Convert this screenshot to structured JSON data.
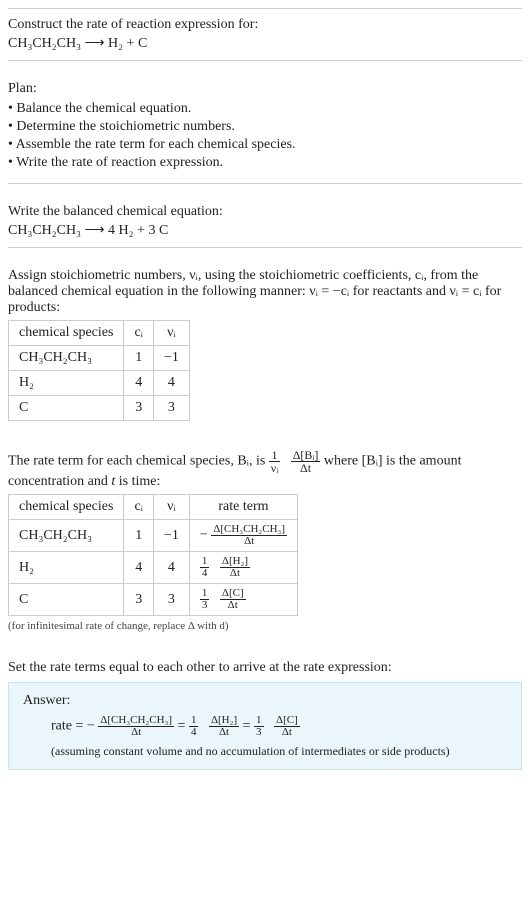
{
  "construct": {
    "title": "Construct the rate of reaction expression for:",
    "equation": "CH₃CH₂CH₃  ⟶  H₂ + C"
  },
  "plan": {
    "title": "Plan:",
    "items": [
      "Balance the chemical equation.",
      "Determine the stoichiometric numbers.",
      "Assemble the rate term for each chemical species.",
      "Write the rate of reaction expression."
    ]
  },
  "balanced": {
    "title": "Write the balanced chemical equation:",
    "equation": "CH₃CH₂CH₃  ⟶  4 H₂ + 3 C"
  },
  "stoich": {
    "intro": "Assign stoichiometric numbers, νᵢ, using the stoichiometric coefficients, cᵢ, from the balanced chemical equation in the following manner: νᵢ = −cᵢ for reactants and νᵢ = cᵢ for products:",
    "headers": {
      "species": "chemical species",
      "c": "cᵢ",
      "v": "νᵢ"
    },
    "rows": [
      {
        "species": "CH₃CH₂CH₃",
        "c": "1",
        "v": "−1"
      },
      {
        "species": "H₂",
        "c": "4",
        "v": "4"
      },
      {
        "species": "C",
        "c": "3",
        "v": "3"
      }
    ]
  },
  "rateterm": {
    "intro_a": "The rate term for each chemical species, Bᵢ, is ",
    "frac1_num": "1",
    "frac1_den": "νᵢ",
    "frac2_num": "Δ[Bᵢ]",
    "frac2_den": "Δt",
    "intro_b": " where [Bᵢ] is the amount concentration and ",
    "intro_c": "t",
    "intro_d": " is time:",
    "headers": {
      "species": "chemical species",
      "c": "cᵢ",
      "v": "νᵢ",
      "rate": "rate term"
    },
    "rows": [
      {
        "species": "CH₃CH₂CH₃",
        "c": "1",
        "v": "−1",
        "lead": "−",
        "a_num": "",
        "a_den": "",
        "b_num": "Δ[CH₃CH₂CH₃]",
        "b_den": "Δt"
      },
      {
        "species": "H₂",
        "c": "4",
        "v": "4",
        "lead": "",
        "a_num": "1",
        "a_den": "4",
        "b_num": "Δ[H₂]",
        "b_den": "Δt"
      },
      {
        "species": "C",
        "c": "3",
        "v": "3",
        "lead": "",
        "a_num": "1",
        "a_den": "3",
        "b_num": "Δ[C]",
        "b_den": "Δt"
      }
    ],
    "note": "(for infinitesimal rate of change, replace Δ with d)"
  },
  "setequal": {
    "title": "Set the rate terms equal to each other to arrive at the rate expression:"
  },
  "answer": {
    "label": "Answer:",
    "prefix": "rate = −",
    "t1_num": "Δ[CH₃CH₂CH₃]",
    "t1_den": "Δt",
    "eq1": " = ",
    "f2a_num": "1",
    "f2a_den": "4",
    "t2_num": "Δ[H₂]",
    "t2_den": "Δt",
    "eq2": " = ",
    "f3a_num": "1",
    "f3a_den": "3",
    "t3_num": "Δ[C]",
    "t3_den": "Δt",
    "note": "(assuming constant volume and no accumulation of intermediates or side products)"
  },
  "chart_data": {
    "type": "table",
    "title": "Stoichiometric numbers and rate terms for CH₃CH₂CH₃ → 4 H₂ + 3 C",
    "columns": [
      "chemical species",
      "cᵢ",
      "νᵢ",
      "rate term"
    ],
    "rows": [
      [
        "CH₃CH₂CH₃",
        1,
        -1,
        "−Δ[CH₃CH₂CH₃]/Δt"
      ],
      [
        "H₂",
        4,
        4,
        "(1/4)Δ[H₂]/Δt"
      ],
      [
        "C",
        3,
        3,
        "(1/3)Δ[C]/Δt"
      ]
    ],
    "rate_expression": "rate = −Δ[CH₃CH₂CH₃]/Δt = (1/4)Δ[H₂]/Δt = (1/3)Δ[C]/Δt"
  }
}
